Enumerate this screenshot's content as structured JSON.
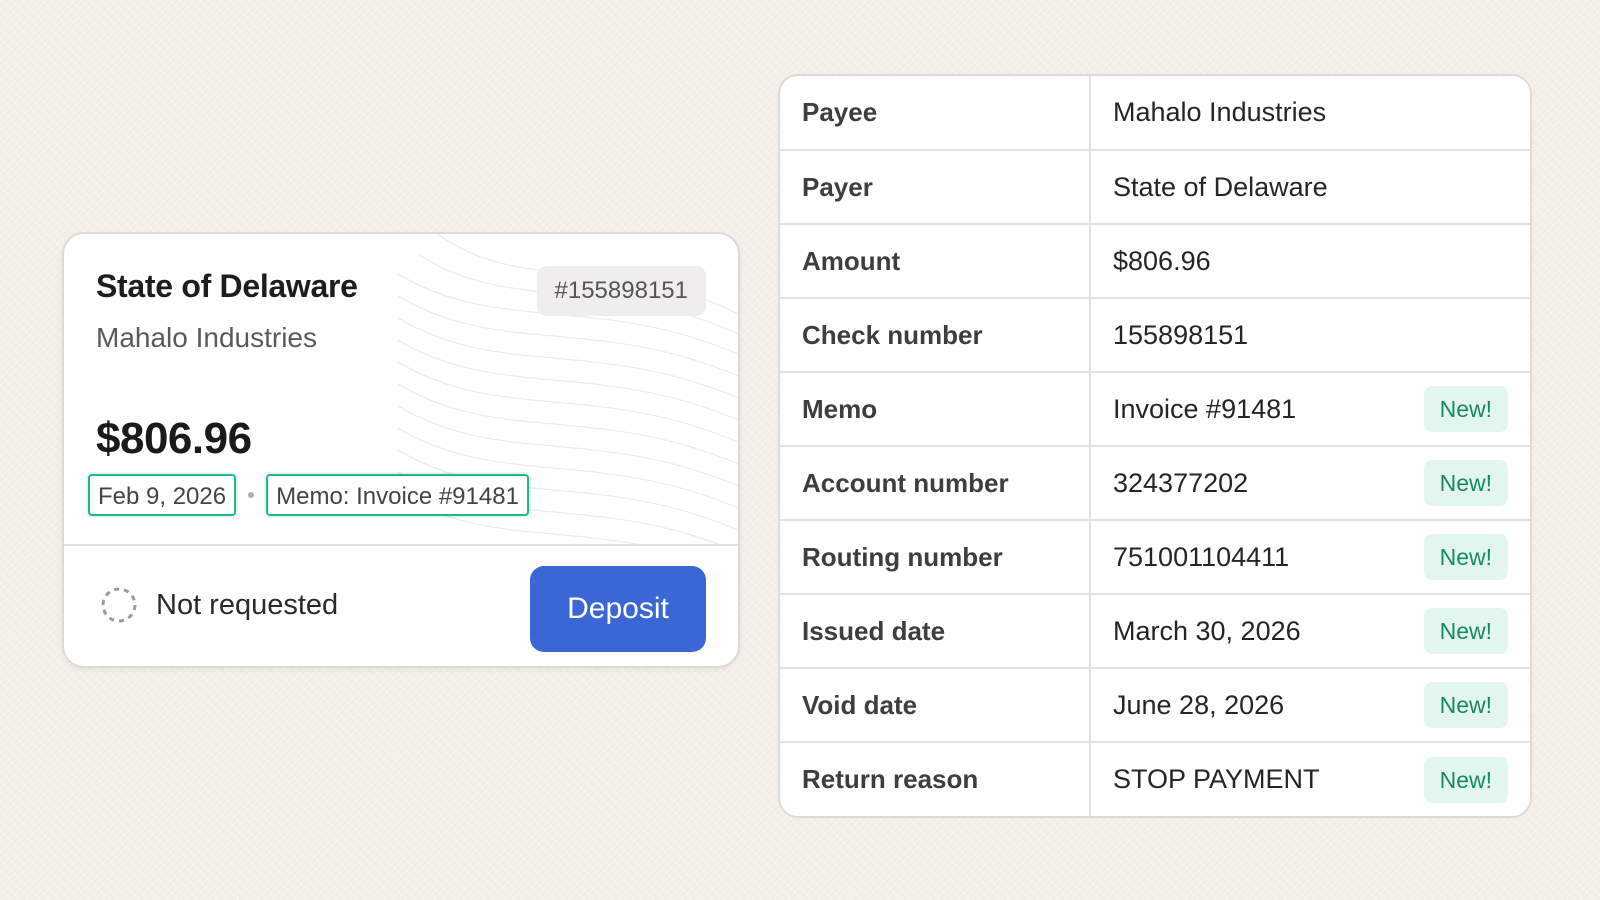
{
  "check_card": {
    "payer": "State of Delaware",
    "payee": "Mahalo Industries",
    "check_number": "#155898151",
    "amount": "$806.96",
    "date": "Feb 9, 2026",
    "memo": "Memo: Invoice #91481",
    "status_icon": "dashed-circle-icon",
    "status": "Not requested",
    "deposit_label": "Deposit"
  },
  "details": {
    "new_label": "New!",
    "rows": [
      {
        "label": "Payee",
        "value": "Mahalo Industries",
        "is_new": false
      },
      {
        "label": "Payer",
        "value": "State of Delaware",
        "is_new": false
      },
      {
        "label": "Amount",
        "value": "$806.96",
        "is_new": false
      },
      {
        "label": "Check number",
        "value": "155898151",
        "is_new": false
      },
      {
        "label": "Memo",
        "value": "Invoice #91481",
        "is_new": true
      },
      {
        "label": "Account number",
        "value": "324377202",
        "is_new": true
      },
      {
        "label": "Routing number",
        "value": "751001104411",
        "is_new": true
      },
      {
        "label": "Issued date",
        "value": "March 30, 2026",
        "is_new": true
      },
      {
        "label": "Void date",
        "value": "June 28, 2026",
        "is_new": true
      },
      {
        "label": "Return reason",
        "value": "STOP PAYMENT",
        "is_new": true
      }
    ]
  },
  "colors": {
    "background": "#f4efe8",
    "accent_blue": "#3a66d6",
    "highlight_green": "#1fb889",
    "new_badge_bg": "#e3f6ee",
    "new_badge_text": "#178a5e"
  }
}
